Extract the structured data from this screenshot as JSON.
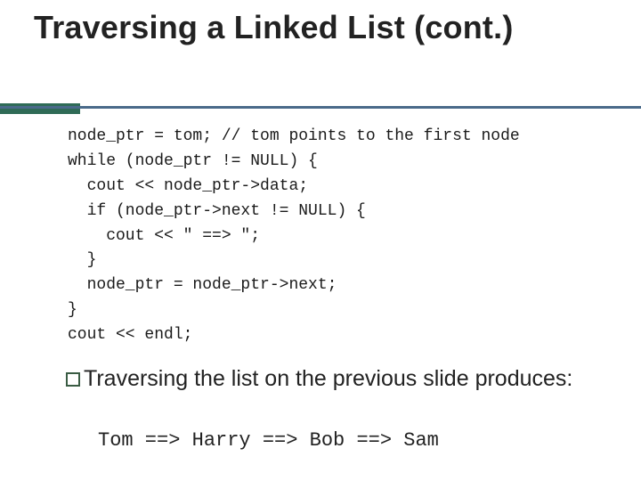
{
  "title": "Traversing a Linked List (cont.)",
  "code": "node_ptr = tom; // tom points to the first node\nwhile (node_ptr != NULL) {\n  cout << node_ptr->data;\n  if (node_ptr->next != NULL) {\n    cout << \" ==> \";\n  }\n  node_ptr = node_ptr->next;\n}\ncout << endl;",
  "body": "Traversing the list on the previous slide produces:",
  "output": "Tom ==> Harry ==> Bob ==> Sam"
}
